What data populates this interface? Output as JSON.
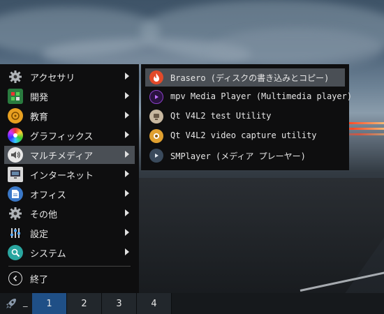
{
  "menu": {
    "items": [
      {
        "label": "アクセサリ",
        "icon": "gear-icon",
        "arrow": true
      },
      {
        "label": "開発",
        "icon": "development-icon",
        "arrow": true
      },
      {
        "label": "教育",
        "icon": "education-icon",
        "arrow": true
      },
      {
        "label": "グラフィックス",
        "icon": "graphics-icon",
        "arrow": true
      },
      {
        "label": "マルチメディア",
        "icon": "multimedia-icon",
        "arrow": true,
        "active": true
      },
      {
        "label": "インターネット",
        "icon": "internet-icon",
        "arrow": true
      },
      {
        "label": "オフィス",
        "icon": "office-icon",
        "arrow": true
      },
      {
        "label": "その他",
        "icon": "gear-icon",
        "arrow": true
      },
      {
        "label": "設定",
        "icon": "settings-icon",
        "arrow": true
      },
      {
        "label": "システム",
        "icon": "system-icon",
        "arrow": true
      }
    ],
    "exit_label": "終了"
  },
  "submenu": {
    "items": [
      {
        "label": "Brasero (ディスクの書き込みとコピー)",
        "icon": "brasero-icon",
        "active": true
      },
      {
        "label": "mpv Media Player (Multimedia player)",
        "icon": "mpv-icon"
      },
      {
        "label": "Qt V4L2 test Utility",
        "icon": "qv4l2-icon"
      },
      {
        "label": "Qt V4L2 video capture utility",
        "icon": "qvidcap-icon"
      },
      {
        "label": "SMPlayer (メディア プレーヤー)",
        "icon": "smplayer-icon"
      }
    ]
  },
  "taskbar": {
    "underscore": "_",
    "desktops": [
      "1",
      "2",
      "3",
      "4"
    ],
    "active_desktop": "1"
  },
  "colors": {
    "menu_bg": "#0e0e0f",
    "highlight": "#4a4f55",
    "active_desktop": "#1f4f86"
  }
}
